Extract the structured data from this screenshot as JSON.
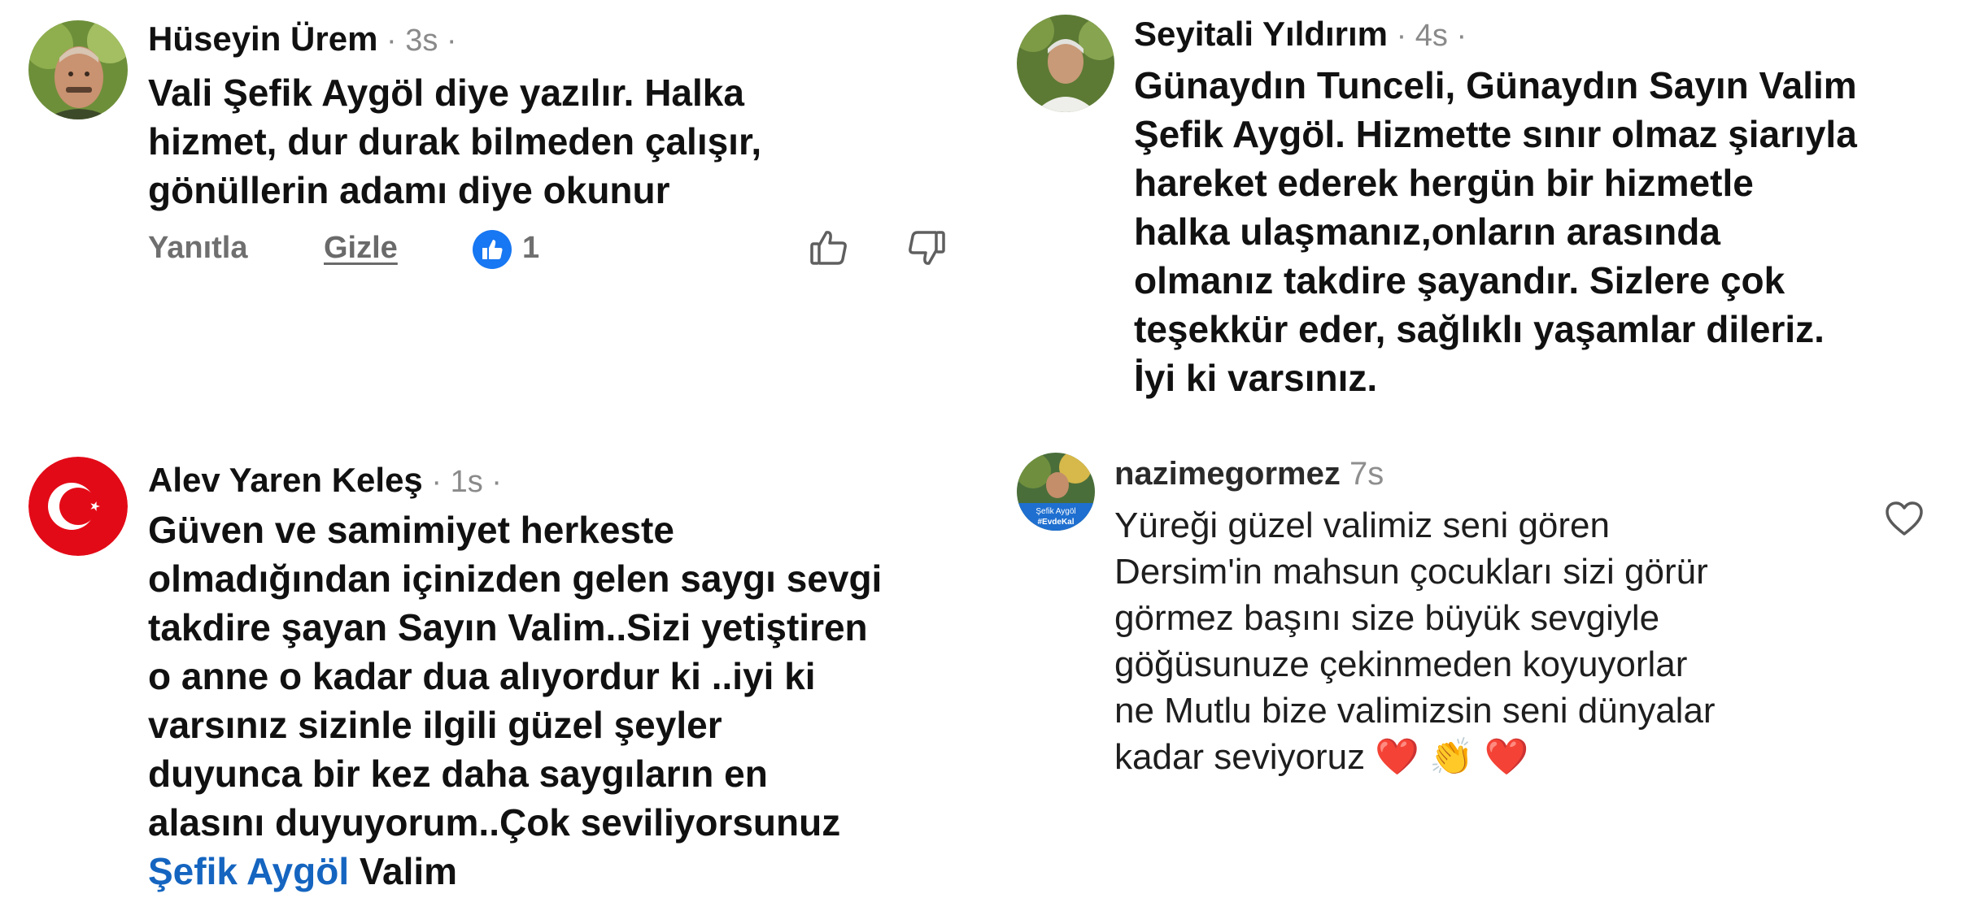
{
  "comments": [
    {
      "author": "Hüseyin Ürem",
      "time": " · 3s ·",
      "lines": [
        "Vali Şefik Aygöl diye yazılır. Halka",
        "hizmet, dur durak bilmeden çalışır,",
        "gönüllerin adamı diye okunur"
      ],
      "actions": {
        "reply": "Yanıtla",
        "hide": "Gizle",
        "reaction_count": "1"
      }
    },
    {
      "author": "Seyitali Yıldırım",
      "time": " · 4s ·",
      "lines": [
        "Günaydın Tunceli, Günaydın Sayın Valim",
        "Şefik Aygöl. Hizmette sınır olmaz şiarıyla",
        "hareket ederek hergün  bir hizmetle",
        "halka ulaşmanız,onların arasında",
        "olmanız takdire şayandır. Sizlere çok",
        "teşekkür eder, sağlıklı yaşamlar dileriz.",
        "İyi ki varsınız."
      ]
    },
    {
      "author": "Alev Yaren Keleş",
      "time": " · 1s ·",
      "lines": [
        "Güven ve  samimiyet herkeste",
        "olmadığından içinizden gelen saygı sevgi",
        "takdire şayan Sayın Valim..Sizi yetiştiren",
        "o anne o kadar dua alıyordur ki ..iyi ki",
        "varsınız sizinle ilgili güzel şeyler",
        "duyunca bir kez daha saygıların en",
        "alasını duyuyorum..Çok seviliyorsunuz"
      ],
      "mention": "Şefik Aygöl",
      "after_mention": " Valim"
    },
    {
      "author": "nazimegormez",
      "time": " 7s",
      "avatar_text": "Şefik Aygöl",
      "avatar_tag": "#EvdeKal",
      "lines": [
        "Yüreği güzel valimiz seni gören",
        "Dersim'in mahsun çocukları sizi görür",
        "görmez başını size büyük sevgiyle",
        "göğüsunuze çekinmeden koyuyorlar",
        "ne Mutlu bize valimizsin seni dünyalar",
        "kadar seviyoruz"
      ],
      "emojis": [
        "❤️",
        "👏",
        "❤️"
      ]
    }
  ],
  "colors": {
    "like_blue": "#1877f2",
    "mention_blue": "#1565c0",
    "flag_red": "#e30a17",
    "heart_red": "#e0182d"
  },
  "icons": [
    "like-reaction-icon",
    "thumbs-up-icon",
    "thumbs-down-icon",
    "heart-outline-icon"
  ]
}
